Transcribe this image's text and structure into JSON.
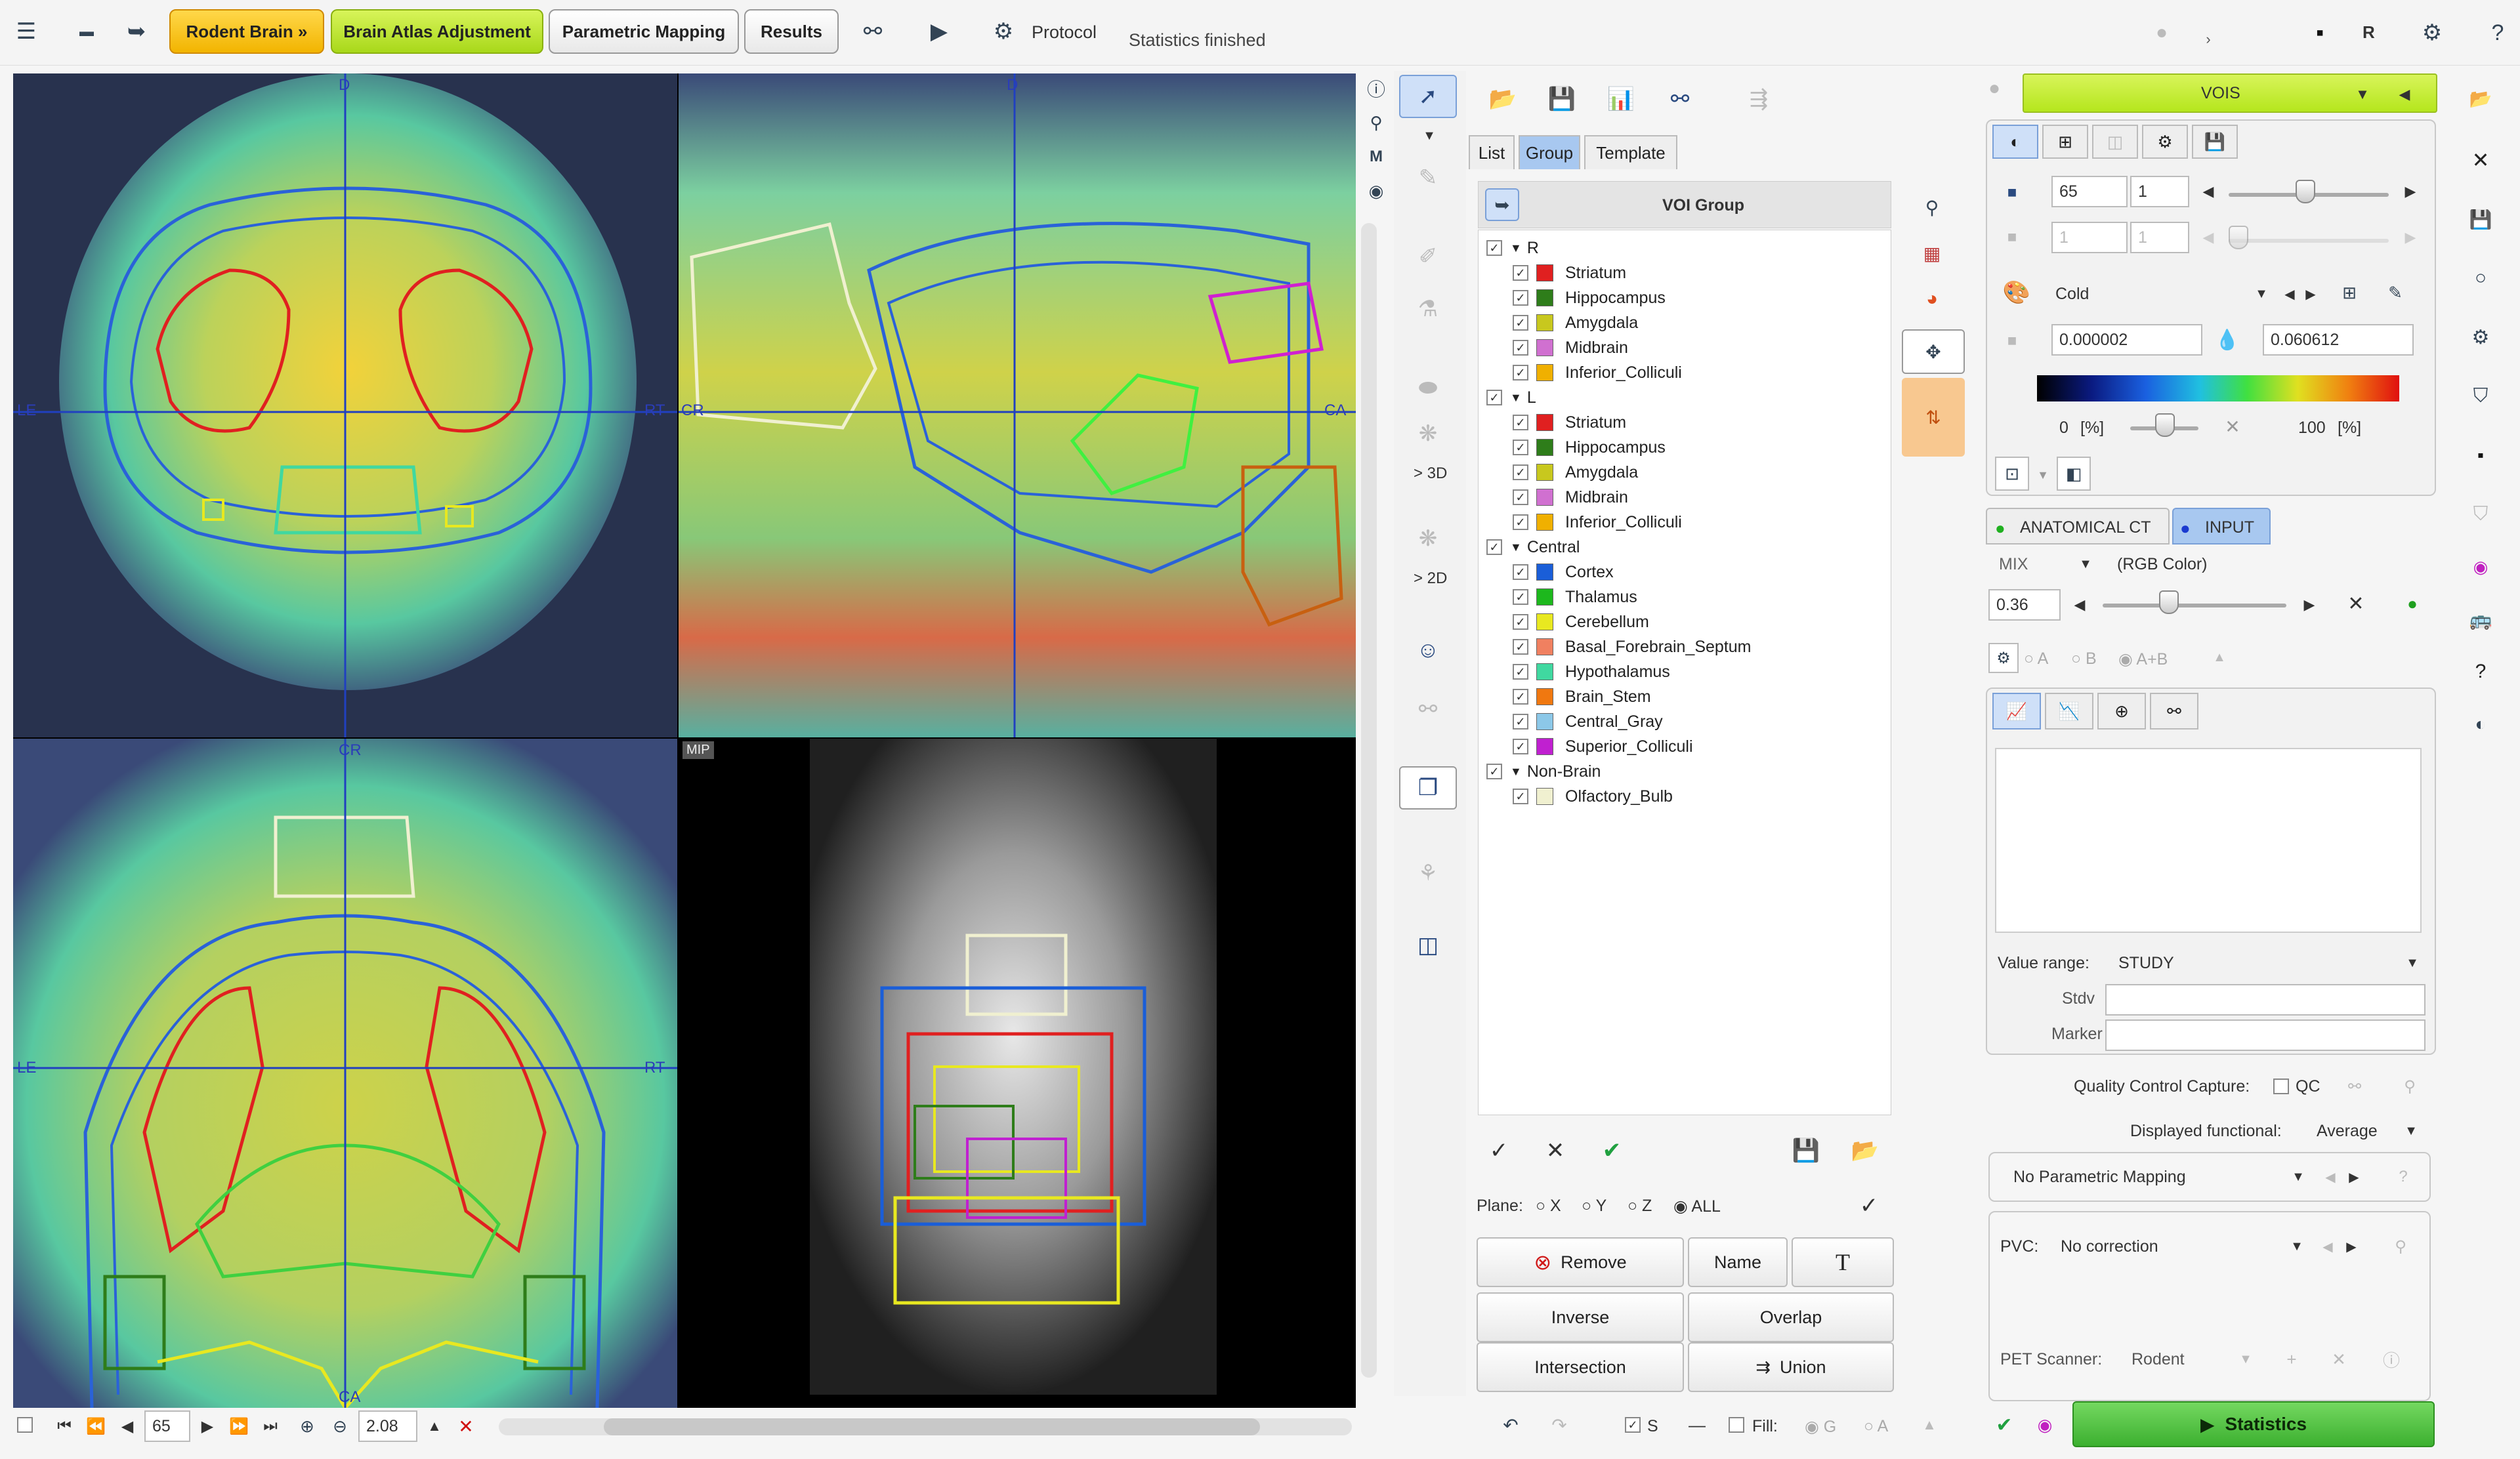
{
  "topbar": {
    "workflow_buttons": [
      "Rodent Brain »",
      "Brain Atlas Adjustment",
      "Parametric Mapping",
      "Results"
    ],
    "protocol_label": "Protocol",
    "status_text": "Statistics finished",
    "right_letter": "R"
  },
  "viewer": {
    "labels": {
      "top_d1": "D",
      "top_d2": "D",
      "le1": "LE",
      "rt1": "RT",
      "cr1": "CR",
      "ca1": "CA",
      "cr2": "CR",
      "le2": "LE",
      "rt2": "RT",
      "ca2": "CA",
      "mip": "MIP"
    },
    "bottom": {
      "slice_value": "65",
      "zoom_value": "2.08"
    }
  },
  "side_toolbar": {
    "label_3d": "> 3D",
    "label_2d": "> 2D"
  },
  "voi_panel": {
    "tabs": [
      "List",
      "Group",
      "Template"
    ],
    "header": "VOI Group",
    "groups": [
      {
        "name": "R",
        "items": [
          {
            "name": "Striatum",
            "color": "#e02020"
          },
          {
            "name": "Hippocampus",
            "color": "#2e7d1a"
          },
          {
            "name": "Amygdala",
            "color": "#c8c81e"
          },
          {
            "name": "Midbrain",
            "color": "#d070d0"
          },
          {
            "name": "Inferior_Colliculi",
            "color": "#f0b000"
          }
        ]
      },
      {
        "name": "L",
        "items": [
          {
            "name": "Striatum",
            "color": "#e02020"
          },
          {
            "name": "Hippocampus",
            "color": "#2e7d1a"
          },
          {
            "name": "Amygdala",
            "color": "#c8c81e"
          },
          {
            "name": "Midbrain",
            "color": "#d070d0"
          },
          {
            "name": "Inferior_Colliculi",
            "color": "#f0b000"
          }
        ]
      },
      {
        "name": "Central",
        "items": [
          {
            "name": "Cortex",
            "color": "#1a5ed8"
          },
          {
            "name": "Thalamus",
            "color": "#1db81d"
          },
          {
            "name": "Cerebellum",
            "color": "#e8e820"
          },
          {
            "name": "Basal_Forebrain_Septum",
            "color": "#f08060"
          },
          {
            "name": "Hypothalamus",
            "color": "#40d8a0"
          },
          {
            "name": "Brain_Stem",
            "color": "#f07810"
          },
          {
            "name": "Central_Gray",
            "color": "#8cc8e8"
          },
          {
            "name": "Superior_Colliculi",
            "color": "#c020d0"
          }
        ]
      },
      {
        "name": "Non-Brain",
        "items": [
          {
            "name": "Olfactory_Bulb",
            "color": "#f0f0d0"
          }
        ]
      }
    ],
    "plane_label": "Plane:",
    "plane_options": [
      "X",
      "Y",
      "Z",
      "ALL"
    ],
    "buttons": {
      "remove": "Remove",
      "name": "Name",
      "text": "T",
      "inverse": "Inverse",
      "overlap": "Overlap",
      "intersection": "Intersection",
      "union": "Union"
    },
    "bottom": {
      "s_label": "S",
      "fill_label": "Fill:",
      "g_label": "G",
      "a_label": "A"
    }
  },
  "right_panel": {
    "vois_dropdown": "VOIS",
    "field_65": "65",
    "field_1": "1",
    "field_1b": "1",
    "field_1c": "1",
    "colormap": "Cold",
    "min_value": "0.000002",
    "max_value": "0.060612",
    "pct_min": "0",
    "pct_unit": "[%]",
    "pct_max": "100",
    "pct_unit2": "[%]",
    "tab_anatomical": "ANATOMICAL CT",
    "tab_input": "INPUT",
    "mix_label": "MIX",
    "mix_mode": "(RGB Color)",
    "mix_value": "0.36",
    "fusion_options": [
      "A",
      "B",
      "A+B"
    ],
    "value_range_label": "Value range:",
    "value_range": "STUDY",
    "stdv_label": "Stdv",
    "marker_label": "Marker",
    "qc_label": "Quality Control Capture:",
    "qc_checkbox": "QC",
    "displayed_functional_label": "Displayed functional:",
    "displayed_functional": "Average",
    "parametric_mapping": "No Parametric Mapping",
    "pvc_label": "PVC:",
    "pvc_value": "No correction",
    "scanner_label": "PET Scanner:",
    "scanner_value": "Rodent",
    "statistics_button": "Statistics"
  },
  "colors": {
    "accent_yellow": "#f7c21a",
    "accent_green": "#b5e61d",
    "stats_green": "#58c84a"
  }
}
